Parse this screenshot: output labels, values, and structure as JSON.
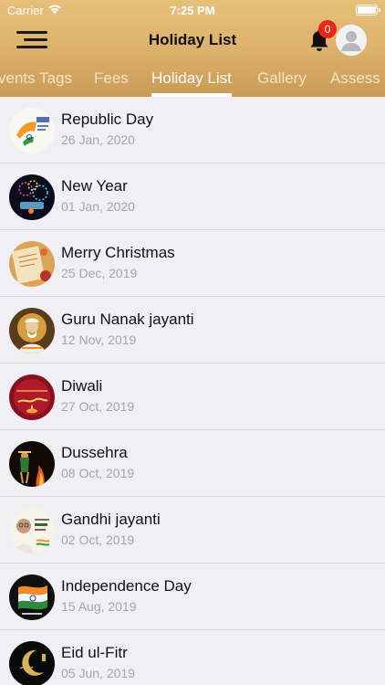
{
  "status_bar": {
    "carrier": "Carrier",
    "time": "7:25 PM"
  },
  "nav": {
    "title": "Holiday List",
    "notification_count": "0",
    "menu_icon": "hamburger-menu-icon",
    "bell_icon": "bell-icon",
    "profile_icon": "user-avatar-icon"
  },
  "tabs": [
    {
      "label": "Events Tags",
      "visible_text": "vents Tags"
    },
    {
      "label": "Fees"
    },
    {
      "label": "Holiday List",
      "active": true
    },
    {
      "label": "Gallery"
    },
    {
      "label": "Assessment",
      "visible_text": "Assess"
    }
  ],
  "colors": {
    "header_gradient_top": "#e6c17a",
    "header_gradient_bottom": "#c99a55",
    "badge": "#e8261b",
    "list_background": "#efeff4",
    "date_text": "#a5a5aa"
  },
  "holidays": [
    {
      "name": "Republic Day",
      "date": "26 Jan, 2020",
      "thumbnail": "republic-day-thumbnail"
    },
    {
      "name": "New Year",
      "date": "01 Jan, 2020",
      "thumbnail": "new-year-fireworks-thumbnail"
    },
    {
      "name": "Merry Christmas",
      "date": "25 Dec, 2019",
      "thumbnail": "christmas-thumbnail"
    },
    {
      "name": "Guru Nanak jayanti",
      "date": "12 Nov, 2019",
      "thumbnail": "guru-nanak-thumbnail"
    },
    {
      "name": "Diwali",
      "date": "27 Oct, 2019",
      "thumbnail": "diwali-thumbnail"
    },
    {
      "name": "Dussehra",
      "date": "08 Oct, 2019",
      "thumbnail": "dussehra-thumbnail"
    },
    {
      "name": "Gandhi jayanti",
      "date": "02 Oct, 2019",
      "thumbnail": "gandhi-jayanti-thumbnail"
    },
    {
      "name": "Independence Day",
      "date": "15 Aug, 2019",
      "thumbnail": "independence-day-thumbnail"
    },
    {
      "name": "Eid ul-Fitr",
      "date": "05 Jun, 2019",
      "thumbnail": "eid-thumbnail"
    }
  ]
}
